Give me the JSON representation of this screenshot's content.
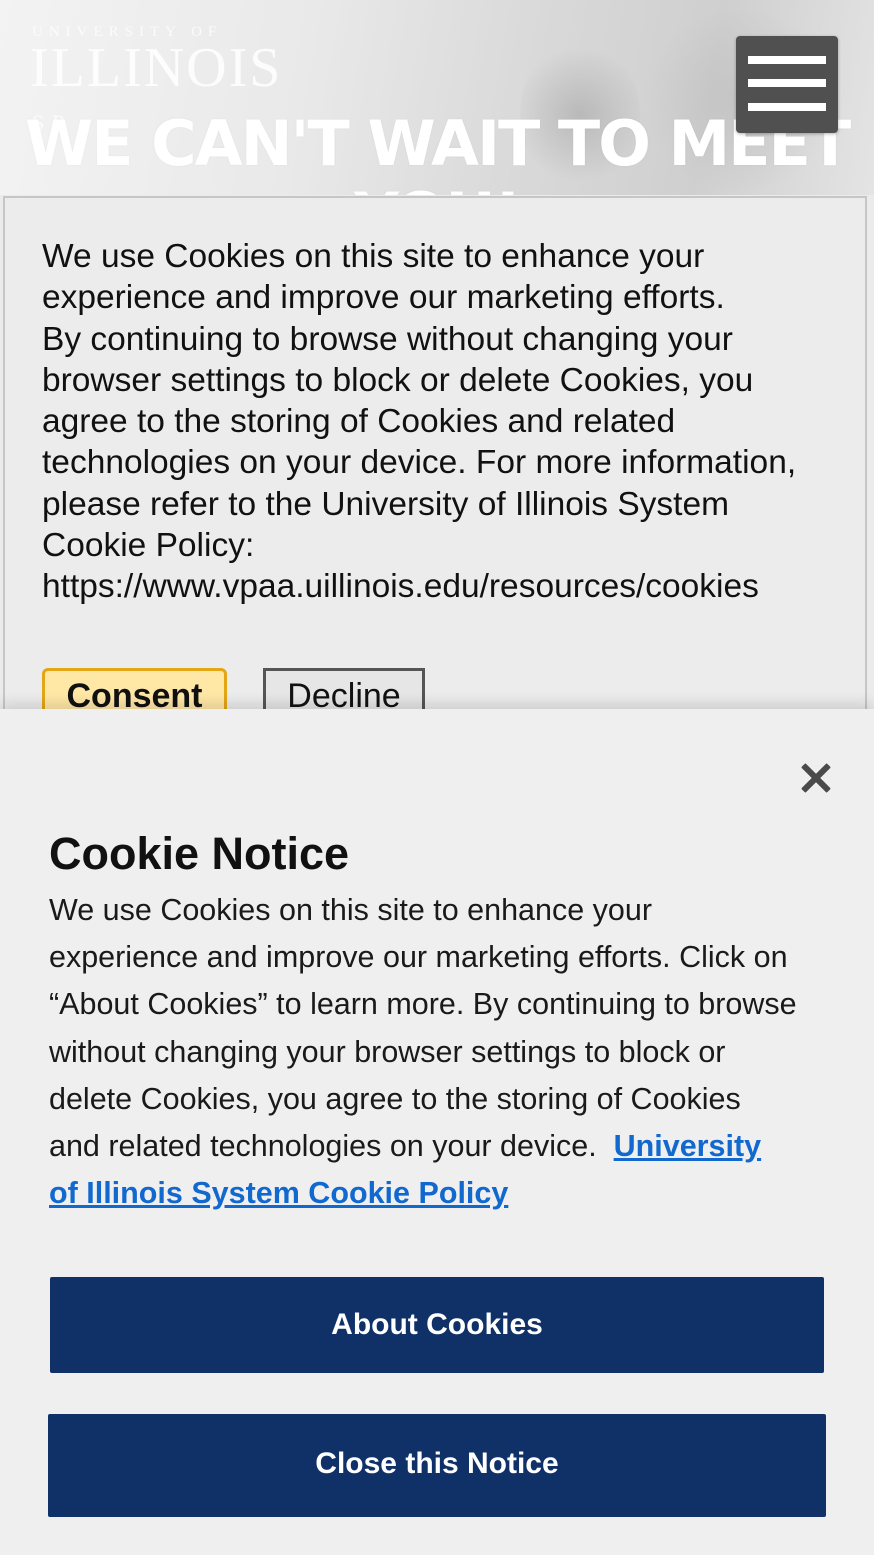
{
  "hero": {
    "brand_top": "UNIVERSITY OF",
    "brand_main": "ILLINOIS",
    "brand_sub": "SP",
    "headline": "WE CAN'T WAIT TO MEET YOU!",
    "menu_icon": "hamburger-menu-icon"
  },
  "cookie_banner": {
    "text": "We use Cookies on this site to enhance your experience and improve our marketing efforts.\nBy continuing to browse without changing your browser settings to block or delete Cookies, you agree to the storing of Cookies and related technologies on your device.  For more information, please refer to the University of Illinois System Cookie Policy:\nhttps://www.vpaa.uillinois.edu/resources/cookies",
    "consent_label": "Consent",
    "decline_label": "Decline",
    "consent_color": "#e3a716"
  },
  "cookie_notice": {
    "close_icon": "close-icon",
    "title": "Cookie Notice",
    "body_lines": [
      "We use Cookies on this site to enhance your",
      "experience and improve our marketing efforts. Click on",
      "“About Cookies” to learn more. By continuing to browse",
      "without changing your browser settings to block or",
      "delete Cookies, you agree to the storing of Cookies",
      "and related technologies on your device.  "
    ],
    "policy_link_line1": "University",
    "policy_link_line2": "of Illinois System Cookie Policy",
    "about_button": "About Cookies",
    "close_button": "Close this Notice",
    "button_color": "#0f3168",
    "link_color": "#1168cf"
  }
}
